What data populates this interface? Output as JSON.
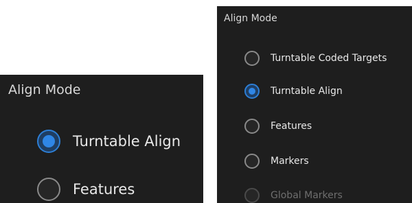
{
  "left_panel": {
    "title": "Align Mode",
    "options": [
      {
        "label": "Turntable Align",
        "selected": true
      },
      {
        "label": "Features",
        "selected": false
      }
    ]
  },
  "right_panel": {
    "title": "Align Mode",
    "options": [
      {
        "label": "Turntable Coded Targets",
        "selected": false
      },
      {
        "label": "Turntable Align",
        "selected": true
      },
      {
        "label": "Features",
        "selected": false
      },
      {
        "label": "Markers",
        "selected": false
      },
      {
        "label": "Global Markers",
        "selected": false,
        "disabled": true
      }
    ]
  },
  "colors": {
    "panel_background": "#1e1e1e",
    "accent": "#2f86e6",
    "text": "#e8e8e8",
    "disabled_text": "#6e6e6e"
  }
}
